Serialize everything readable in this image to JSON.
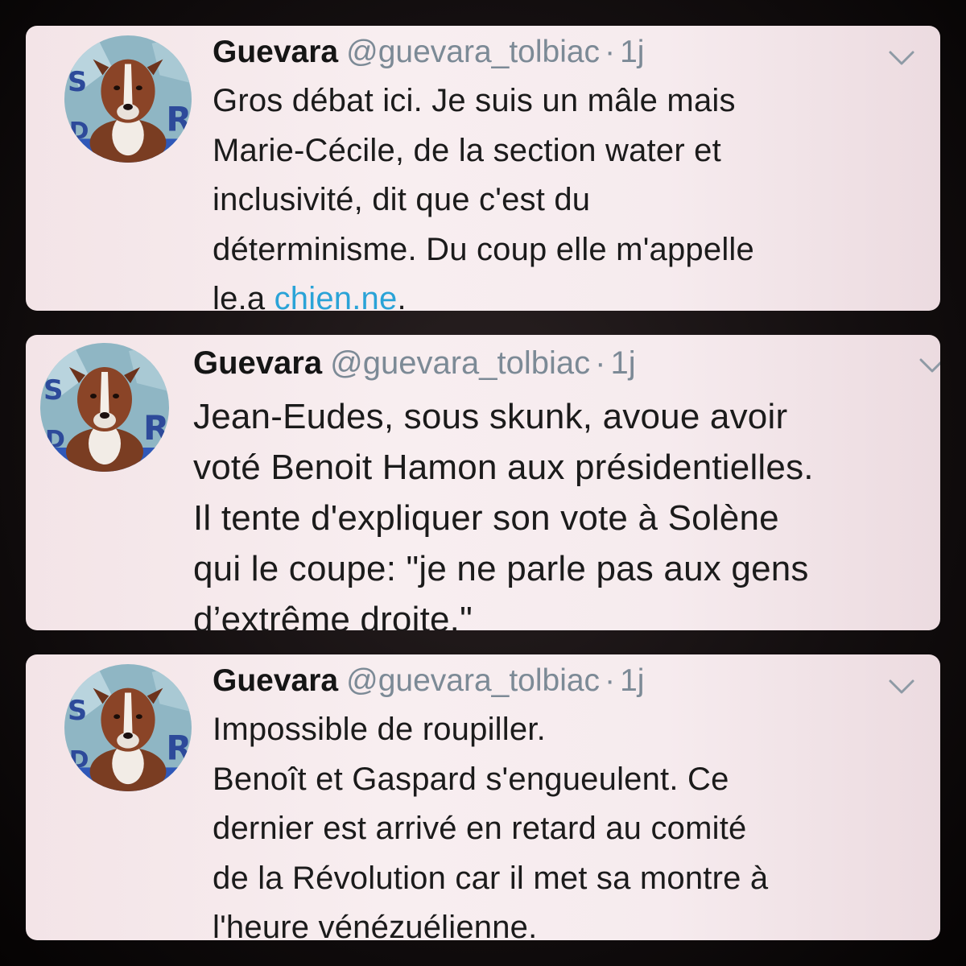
{
  "tweets": [
    {
      "name": "Guevara",
      "handle": "@guevara_tolbiac",
      "separator": "·",
      "time": "1j",
      "text": "Gros débat ici. Je suis un mâle mais\nMarie-Cécile, de la section water et\ninclusivité, dit que c'est du\ndéterminisme. Du coup elle m'appelle\nle.a ",
      "link": "chien.ne",
      "text_end": ".",
      "avatar_icon": "dog-avatar-icon",
      "menu_icon": "chevron-down-icon"
    },
    {
      "name": "Guevara",
      "handle": "@guevara_tolbiac",
      "separator": "·",
      "time": "1j",
      "text": "Jean-Eudes, sous skunk, avoue avoir\nvoté Benoit Hamon aux présidentielles.\nIl tente d'expliquer son vote à Solène\nqui le coupe:  \"je ne parle pas aux gens\nd’extrême droite.\"",
      "avatar_icon": "dog-avatar-icon",
      "menu_icon": "chevron-down-icon"
    },
    {
      "name": "Guevara",
      "handle": "@guevara_tolbiac",
      "separator": "·",
      "time": "1j",
      "text": "Impossible de roupiller.\nBenoît et Gaspard s'engueulent. Ce\ndernier est arrivé en retard au comité\nde la Révolution car il met sa montre à\nl'heure vénézuélienne.",
      "avatar_icon": "dog-avatar-icon",
      "menu_icon": "chevron-down-icon"
    }
  ],
  "colors": {
    "link": "#2aa3d7",
    "muted": "#7c8a96",
    "card_bg": "#f6ebee",
    "page_bg": "#140f10"
  }
}
